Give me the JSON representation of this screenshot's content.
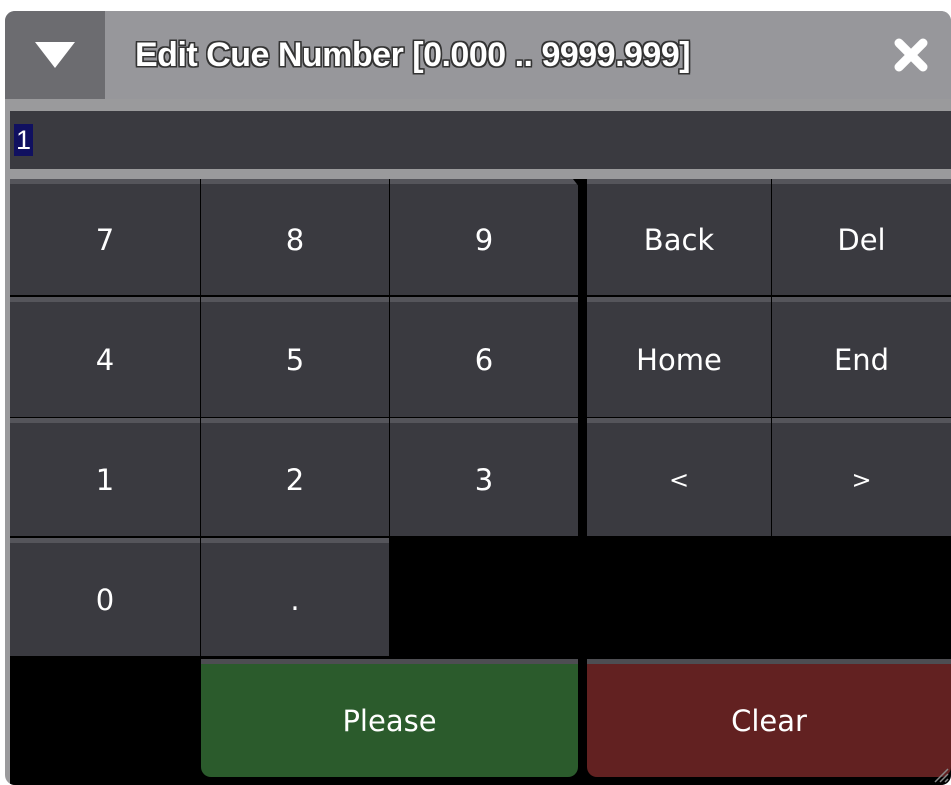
{
  "dialog": {
    "title": "Edit Cue Number [0.000 .. 9999.999]",
    "dropdown_icon": "triangle-down-icon",
    "close_icon": "close-x-icon"
  },
  "input": {
    "value": "1",
    "selected": true
  },
  "keys": {
    "k7": "7",
    "k8": "8",
    "k9": "9",
    "k4": "4",
    "k5": "5",
    "k6": "6",
    "k1": "1",
    "k2": "2",
    "k3": "3",
    "k0": "0",
    "dot": ".",
    "back": "Back",
    "del": "Del",
    "home": "Home",
    "end": "End",
    "left": "<",
    "right": ">",
    "please": "Please",
    "clear": "Clear"
  },
  "colors": {
    "please_bg": "#2b5b2c",
    "clear_bg": "#622121",
    "key_bg": "#3a3a40",
    "selection_bg": "#101060"
  }
}
